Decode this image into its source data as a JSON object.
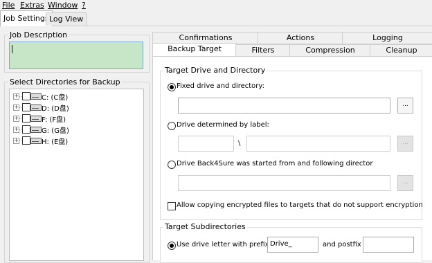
{
  "menu": {
    "file": "File",
    "extras": "Extras",
    "window": "Window",
    "help": "?"
  },
  "top_tabs": {
    "job_settings": "Job Settings",
    "log_view": "Log View"
  },
  "job_description": {
    "legend": "Job Description",
    "value": ""
  },
  "directories": {
    "legend": "Select Directories for Backup",
    "drives": [
      "C: (C盘)",
      "D: (D盘)",
      "F: (F盘)",
      "G: (G盘)",
      "H: (E盘)"
    ]
  },
  "tabs": {
    "row1": [
      "Confirmations",
      "Actions",
      "Logging"
    ],
    "row2": [
      "Backup Target",
      "Filters",
      "Compression",
      "Cleanup"
    ]
  },
  "target": {
    "legend": "Target Drive and Directory",
    "fixed_label": "Fixed drive and directory:",
    "fixed_value": "",
    "label_option": "Drive determined by label:",
    "separator": "\\",
    "started_option": "Drive Back4Sure was started from and following director",
    "browse": "...",
    "encrypt_label": "Allow copying encrypted files to targets that do not support encryption"
  },
  "subdirs": {
    "legend": "Target Subdirectories",
    "use_prefix_label": "Use drive letter with prefix",
    "prefix_value": "Drive_",
    "postfix_label": "and postfix",
    "postfix_value": ""
  }
}
